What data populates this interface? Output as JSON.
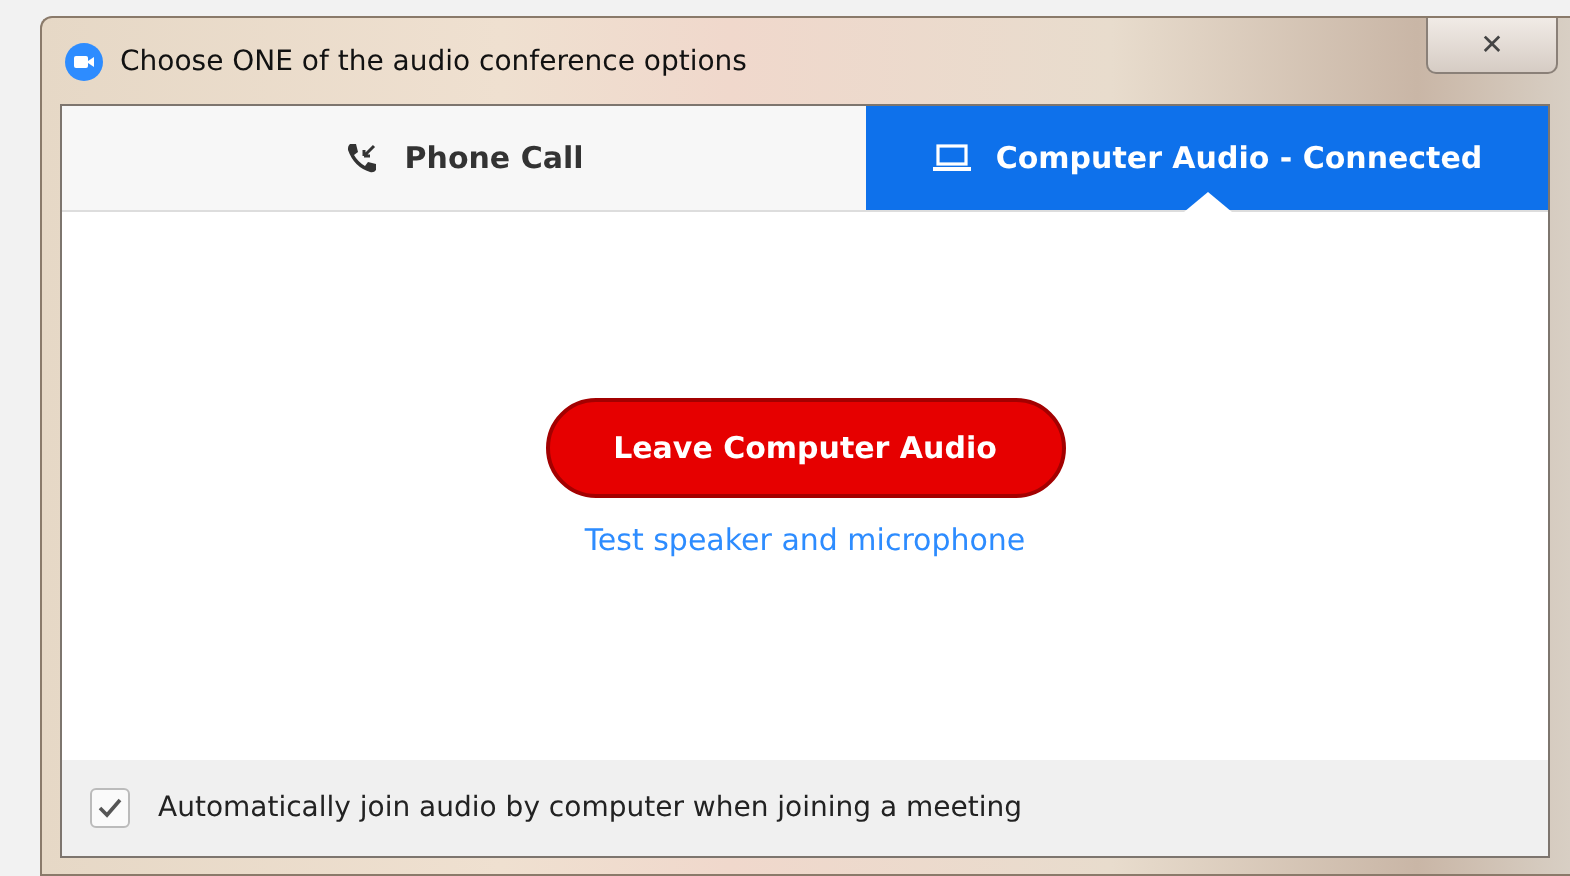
{
  "window": {
    "title": "Choose ONE of the audio conference options",
    "close": "✕"
  },
  "tabs": [
    {
      "label": "Phone Call",
      "kind": "phone",
      "selected": false
    },
    {
      "label": "Computer Audio - Connected",
      "kind": "computer",
      "selected": true
    }
  ],
  "leave_button": "Leave Computer Audio",
  "test_link": "Test speaker and microphone",
  "auto_join": {
    "label": "Automatically join audio by computer when joining a meeting",
    "checked": true
  }
}
